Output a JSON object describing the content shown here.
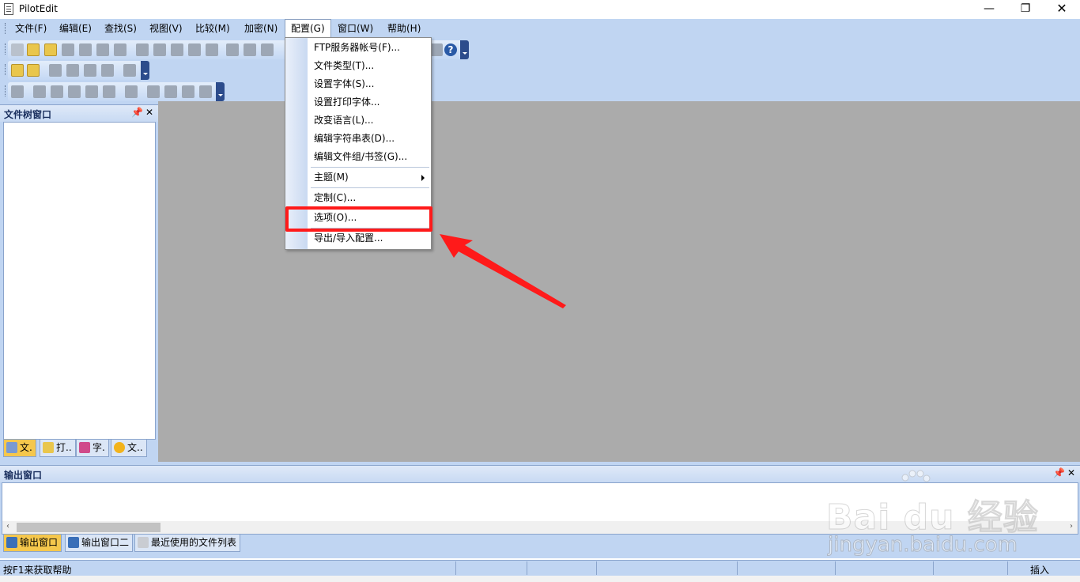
{
  "window": {
    "title": "PilotEdit",
    "min_glyph": "—",
    "max_glyph": "❐",
    "close_glyph": "✕"
  },
  "menubar": {
    "items": [
      "文件(F)",
      "编辑(E)",
      "查找(S)",
      "视图(V)",
      "比较(M)",
      "加密(N)",
      "配置(G)",
      "窗口(W)",
      "帮助(H)"
    ],
    "active": "配置(G)"
  },
  "config_menu": {
    "items": [
      {
        "label": "FTP服务器帐号(F)..."
      },
      {
        "label": "文件类型(T)..."
      },
      {
        "label": "设置字体(S)..."
      },
      {
        "label": "设置打印字体..."
      },
      {
        "label": "改变语言(L)..."
      },
      {
        "label": "编辑字符串表(D)..."
      },
      {
        "label": "编辑文件组/书签(G)..."
      },
      {
        "label": "主题(M)"
      },
      {
        "label": "定制(C)..."
      },
      {
        "label": "选项(O)..."
      },
      {
        "label": "导出/导入配置..."
      }
    ],
    "highlighted": "选项(O)..."
  },
  "file_tree_pane": {
    "title": "文件树窗口",
    "pin_glyph": "📌",
    "close_glyph": "✕",
    "tabs": [
      "文.",
      "打..",
      "字.",
      "文.."
    ]
  },
  "output_pane": {
    "title": "输出窗口",
    "pin_glyph": "📌",
    "close_glyph": "✕",
    "tabs": [
      "输出窗口",
      "输出窗口二",
      "最近使用的文件列表"
    ],
    "scroll_left": "‹",
    "scroll_right": "›"
  },
  "statusbar": {
    "text": "按F1来获取帮助",
    "mode": "插入"
  },
  "toolbar": {
    "help_glyph": "?",
    "icons": [
      "new-file-icon",
      "open-file-icon",
      "save-icon",
      "save-all-icon",
      "close-icon",
      "undo-icon",
      "redo-icon",
      "cut-icon",
      "copy-icon",
      "paste-icon",
      "help-icon"
    ]
  },
  "watermark": {
    "brand": "Bai du 经验",
    "url": "jingyan.baidu.com"
  },
  "colors": {
    "chrome": "#c0d5f2",
    "mdi_background": "#ababab",
    "annotation_red": "#ff1a1a"
  }
}
